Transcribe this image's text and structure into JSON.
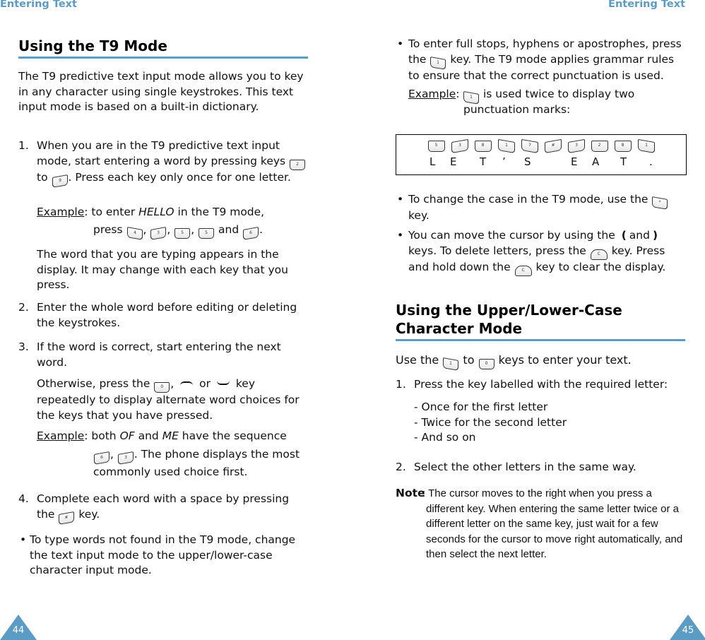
{
  "left_page": {
    "running_head": "Entering Text",
    "section_title": "Using the T9 Mode",
    "intro": "The T9 predictive text input mode allows you to key in any character using single keystrokes. This text input mode is based on a built-in dictionary.",
    "steps": [
      {
        "number": "1.",
        "text_a": "When you are in the T9 predictive text input mode, start entering a word by pressing keys",
        "key_from": "2",
        "key_to": "9",
        "text_to": "to",
        "text_b": ". Press each key only once for one letter.",
        "example_label": "Example",
        "example_text_a": ": to enter ",
        "example_word": "HELLO",
        "example_text_b": " in the T9 mode,",
        "example_press": "press",
        "example_keys": [
          "4",
          "3",
          "5",
          "5",
          "6"
        ],
        "example_and": "and",
        "followup": "The word that you are typing appears in the display. It may change with each key that you press."
      },
      {
        "number": "2.",
        "text": "Enter the whole word before editing or deleting the keystrokes."
      },
      {
        "number": "3.",
        "text": "If the word is correct, start entering the next word.",
        "otherwise_a": "Otherwise, press the",
        "otherwise_key": "0",
        "otherwise_or": "or",
        "otherwise_b": "key repeatedly to display alternate word choices for the keys that you have pressed.",
        "example_label": "Example",
        "example_a": ": both ",
        "example_w1": "OF",
        "example_and": " and ",
        "example_w2": "ME",
        "example_b": " have the sequence",
        "example_keys": [
          "6",
          "3"
        ],
        "example_c": ". The phone displays the most commonly used choice first."
      },
      {
        "number": "4.",
        "text_a": "Complete each word with a space by pressing the",
        "key": "#",
        "text_b": "key."
      }
    ],
    "bullet": "To type words not found in the T9 mode, change the text input mode to the upper/lower-case character input mode.",
    "page_number": "44"
  },
  "right_page": {
    "running_head": "Entering Text",
    "bullet1_a": "To enter full stops, hyphens or apostrophes, press the",
    "bullet1_key": "1",
    "bullet1_b": "key. The T9 mode applies grammar rules to ensure that the correct punctuation is used.",
    "example_label": "Example",
    "example_key": "1",
    "example_text": "is used twice to display two punctuation marks:",
    "example_box": {
      "keys": [
        "5",
        "3",
        "8",
        "1",
        "7",
        "#",
        "3",
        "2",
        "8",
        "1"
      ],
      "letters": [
        "L",
        "E",
        "T",
        "’",
        "S",
        "E",
        "A",
        "T",
        "."
      ]
    },
    "bullet2_a": "To change the case in the T9 mode, use the",
    "bullet2_key": "*",
    "bullet2_b": "key.",
    "bullet3_a": "You can move the cursor by using the",
    "bullet3_left": "(",
    "bullet3_and": "and",
    "bullet3_right": ")",
    "bullet3_b": "keys. To delete letters, press the",
    "bullet3_c_key": "C",
    "bullet3_c": "key. Press and hold down the",
    "bullet3_d": "key to clear the display.",
    "section_title_1": "Using the Upper/Lower-Case",
    "section_title_2": "Character Mode",
    "intro_a": "Use the",
    "intro_key1": "1",
    "intro_to": "to",
    "intro_key2": "0",
    "intro_b": "keys to enter your text.",
    "step1_num": "1.",
    "step1": "Press the key labelled with the required letter:",
    "sub_items": [
      "- Once for the first letter",
      "- Twice for the second letter",
      "- And so on"
    ],
    "step2_num": "2.",
    "step2": "Select the other letters in the same way.",
    "note_label": "Note",
    "note_text": ": The cursor moves to the right when you press a different key. When entering the same letter twice or a different letter on the same key, just wait for a few seconds for the cursor to move right automatically, and then select the next letter.",
    "page_number": "45"
  }
}
